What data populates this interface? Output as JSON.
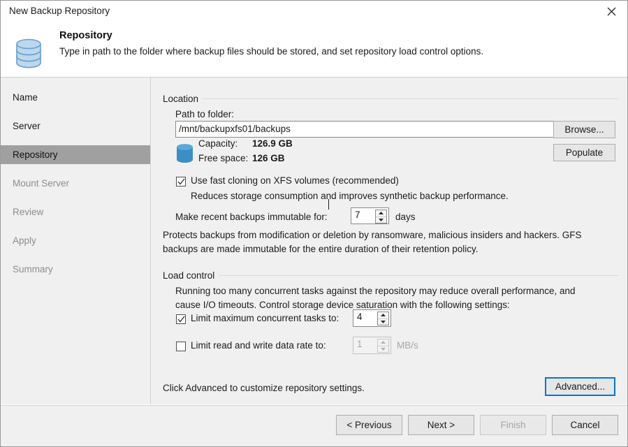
{
  "window": {
    "title": "New Backup Repository",
    "close_icon": "close-icon"
  },
  "header": {
    "icon": "database-repository-icon",
    "title": "Repository",
    "subtitle": "Type in path to the folder where backup files should be stored, and set repository load control options."
  },
  "sidebar": {
    "items": [
      {
        "label": "Name",
        "state": "done"
      },
      {
        "label": "Server",
        "state": "done"
      },
      {
        "label": "Repository",
        "state": "active"
      },
      {
        "label": "Mount Server",
        "state": "upcoming"
      },
      {
        "label": "Review",
        "state": "upcoming"
      },
      {
        "label": "Apply",
        "state": "upcoming"
      },
      {
        "label": "Summary",
        "state": "upcoming"
      }
    ]
  },
  "location": {
    "group_label": "Location",
    "path_label": "Path to folder:",
    "path_value": "/mnt/backupxfs01/backups",
    "browse_label": "Browse...",
    "populate_label": "Populate",
    "storage_icon": "database-icon",
    "capacity_label": "Capacity:",
    "capacity_value": "126.9 GB",
    "free_space_label": "Free space:",
    "free_space_value": "126 GB",
    "fast_clone_label": "Use fast cloning on XFS volumes (recommended)",
    "fast_clone_checked": true,
    "fast_clone_hint": "Reduces storage consumption and improves synthetic backup performance.",
    "immutable_label": "Make recent backups immutable for:",
    "immutable_value": "7",
    "immutable_units": "days",
    "immutable_hint_line1": "Protects backups from modification or deletion by ransomware, malicious insiders and hackers. GFS",
    "immutable_hint_line2": "backups are made immutable for the entire duration of their retention policy."
  },
  "load_control": {
    "group_label": "Load control",
    "hint_line1": "Running too many concurrent tasks against the repository may reduce overall performance, and",
    "hint_line2": "cause I/O timeouts. Control storage device saturation with the following settings:",
    "limit_tasks_label": "Limit maximum concurrent tasks to:",
    "limit_tasks_checked": true,
    "limit_tasks_value": "4",
    "limit_rate_label": "Limit read and write data rate to:",
    "limit_rate_checked": false,
    "limit_rate_value": "1",
    "limit_rate_units": "MB/s"
  },
  "advanced": {
    "hint": "Click Advanced to customize repository settings.",
    "button_label": "Advanced..."
  },
  "footer": {
    "previous_label": "< Previous",
    "next_label": "Next >",
    "finish_label": "Finish",
    "cancel_label": "Cancel",
    "finish_disabled": true
  },
  "colors": {
    "accent": "#0078d7",
    "selection": "#a0a0a0",
    "icon_blue": "#4a90c8",
    "window_bg": "#f0f0f0"
  }
}
